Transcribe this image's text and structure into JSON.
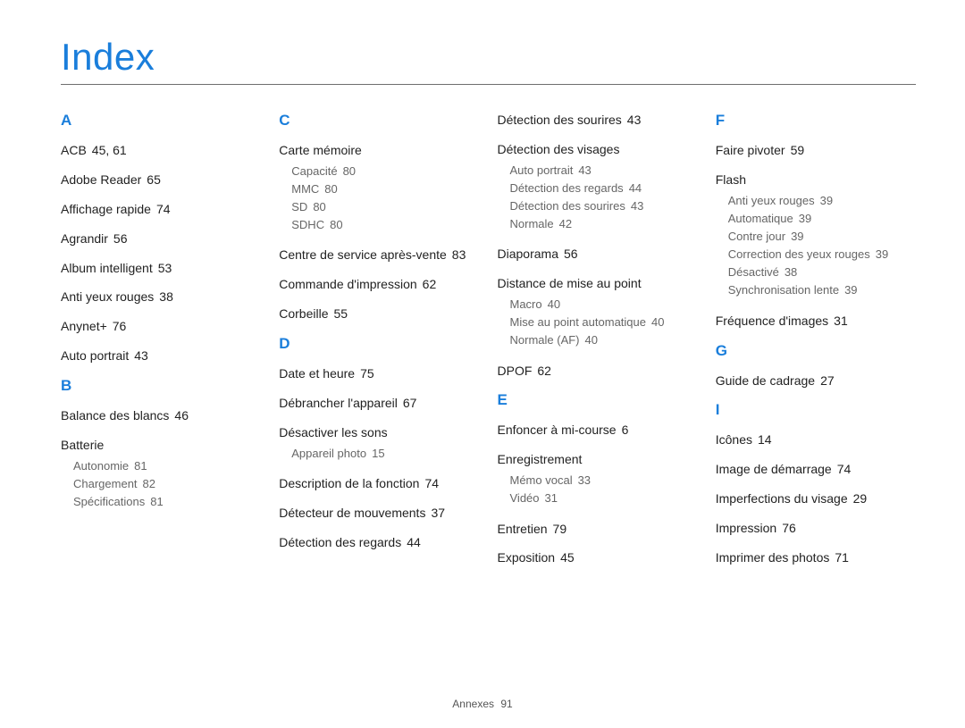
{
  "title": "Index",
  "footer": {
    "section": "Annexes",
    "page": "91"
  },
  "columns": [
    [
      {
        "type": "letter",
        "v": "A"
      },
      {
        "type": "l1",
        "label": "ACB",
        "pages": "45, 61"
      },
      {
        "type": "l1",
        "label": "Adobe Reader",
        "pages": "65"
      },
      {
        "type": "l1",
        "label": "Affichage rapide",
        "pages": "74"
      },
      {
        "type": "l1",
        "label": "Agrandir",
        "pages": "56"
      },
      {
        "type": "l1",
        "label": "Album intelligent",
        "pages": "53"
      },
      {
        "type": "l1",
        "label": "Anti yeux rouges",
        "pages": "38"
      },
      {
        "type": "l1",
        "label": "Anynet+",
        "pages": "76"
      },
      {
        "type": "l1",
        "label": "Auto portrait",
        "pages": "43"
      },
      {
        "type": "letter",
        "v": "B"
      },
      {
        "type": "l1",
        "label": "Balance des blancs",
        "pages": "46"
      },
      {
        "type": "l1",
        "label": "Batterie",
        "pages": "",
        "sub": [
          {
            "label": "Autonomie",
            "pages": "81"
          },
          {
            "label": "Chargement",
            "pages": "82"
          },
          {
            "label": "Spécifications",
            "pages": "81"
          }
        ]
      }
    ],
    [
      {
        "type": "letter",
        "v": "C"
      },
      {
        "type": "l1",
        "label": "Carte mémoire",
        "pages": "",
        "sub": [
          {
            "label": "Capacité",
            "pages": "80"
          },
          {
            "label": "MMC",
            "pages": "80"
          },
          {
            "label": "SD",
            "pages": "80"
          },
          {
            "label": "SDHC",
            "pages": "80"
          }
        ]
      },
      {
        "type": "l1",
        "label": "Centre de service après-vente",
        "pages": "83"
      },
      {
        "type": "l1",
        "label": "Commande d'impression",
        "pages": "62"
      },
      {
        "type": "l1",
        "label": "Corbeille",
        "pages": "55"
      },
      {
        "type": "letter",
        "v": "D"
      },
      {
        "type": "l1",
        "label": "Date et heure",
        "pages": "75"
      },
      {
        "type": "l1",
        "label": "Débrancher l'appareil",
        "pages": "67"
      },
      {
        "type": "l1",
        "label": "Désactiver les sons",
        "pages": "",
        "sub": [
          {
            "label": "Appareil photo",
            "pages": "15"
          }
        ]
      },
      {
        "type": "l1",
        "label": "Description de la fonction",
        "pages": "74"
      },
      {
        "type": "l1",
        "label": "Détecteur de mouvements",
        "pages": "37"
      },
      {
        "type": "l1",
        "label": "Détection des regards",
        "pages": "44"
      }
    ],
    [
      {
        "type": "l1",
        "label": "Détection des sourires",
        "pages": "43"
      },
      {
        "type": "l1",
        "label": "Détection des visages",
        "pages": "",
        "sub": [
          {
            "label": "Auto portrait",
            "pages": "43"
          },
          {
            "label": "Détection des regards",
            "pages": "44"
          },
          {
            "label": "Détection des sourires",
            "pages": "43"
          },
          {
            "label": "Normale",
            "pages": "42"
          }
        ]
      },
      {
        "type": "l1",
        "label": "Diaporama",
        "pages": "56"
      },
      {
        "type": "l1",
        "label": "Distance de mise au point",
        "pages": "",
        "sub": [
          {
            "label": "Macro",
            "pages": "40"
          },
          {
            "label": "Mise au point automatique",
            "pages": "40"
          },
          {
            "label": "Normale (AF)",
            "pages": "40"
          }
        ]
      },
      {
        "type": "l1",
        "label": "DPOF",
        "pages": "62"
      },
      {
        "type": "letter",
        "v": "E"
      },
      {
        "type": "l1",
        "label": "Enfoncer à mi-course",
        "pages": "6"
      },
      {
        "type": "l1",
        "label": "Enregistrement",
        "pages": "",
        "sub": [
          {
            "label": "Mémo vocal",
            "pages": "33"
          },
          {
            "label": "Vidéo",
            "pages": "31"
          }
        ]
      },
      {
        "type": "l1",
        "label": "Entretien",
        "pages": "79"
      },
      {
        "type": "l1",
        "label": "Exposition",
        "pages": "45"
      }
    ],
    [
      {
        "type": "letter",
        "v": "F"
      },
      {
        "type": "l1",
        "label": "Faire pivoter",
        "pages": "59"
      },
      {
        "type": "l1",
        "label": "Flash",
        "pages": "",
        "sub": [
          {
            "label": "Anti yeux rouges",
            "pages": "39"
          },
          {
            "label": "Automatique",
            "pages": "39"
          },
          {
            "label": "Contre jour",
            "pages": "39"
          },
          {
            "label": "Correction des yeux rouges",
            "pages": "39"
          },
          {
            "label": "Désactivé",
            "pages": "38"
          },
          {
            "label": "Synchronisation lente",
            "pages": "39"
          }
        ]
      },
      {
        "type": "l1",
        "label": "Fréquence d'images",
        "pages": "31"
      },
      {
        "type": "letter",
        "v": "G"
      },
      {
        "type": "l1",
        "label": "Guide de cadrage",
        "pages": "27"
      },
      {
        "type": "letter",
        "v": "I"
      },
      {
        "type": "l1",
        "label": "Icônes",
        "pages": "14"
      },
      {
        "type": "l1",
        "label": "Image de démarrage",
        "pages": "74"
      },
      {
        "type": "l1",
        "label": "Imperfections du visage",
        "pages": "29"
      },
      {
        "type": "l1",
        "label": "Impression",
        "pages": "76"
      },
      {
        "type": "l1",
        "label": "Imprimer des photos",
        "pages": "71"
      }
    ]
  ]
}
